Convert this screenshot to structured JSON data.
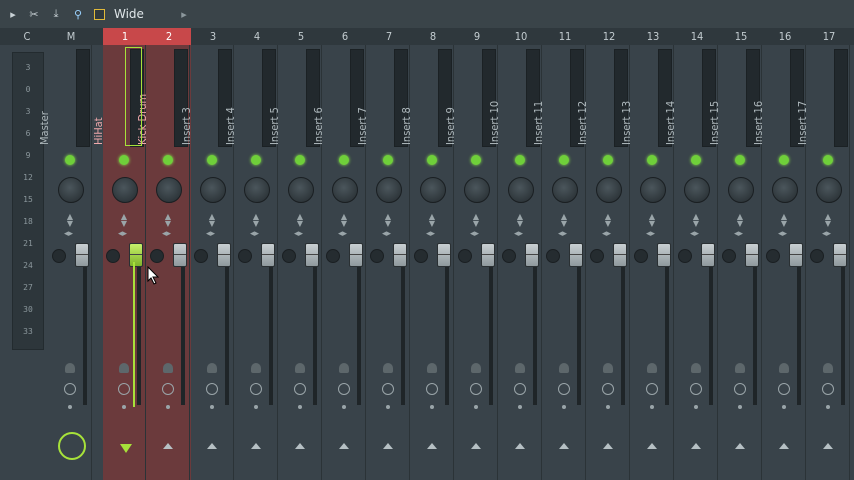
{
  "toolbar": {
    "preset": "Wide"
  },
  "header": {
    "c": "C",
    "m": "M",
    "numbers": [
      "1",
      "2",
      "3",
      "4",
      "5",
      "6",
      "7",
      "8",
      "9",
      "10",
      "11",
      "12",
      "13",
      "14",
      "15",
      "16",
      "17"
    ]
  },
  "scale": [
    "3",
    "0",
    "3",
    "6",
    "9",
    "12",
    "15",
    "18",
    "21",
    "24",
    "27",
    "30",
    "33"
  ],
  "channels": {
    "master": "Master",
    "inserts": [
      "HiHat",
      "Kick Drum",
      "Insert 3",
      "Insert 4",
      "Insert 5",
      "Insert 6",
      "Insert 7",
      "Insert 8",
      "Insert 9",
      "Insert 10",
      "Insert 11",
      "Insert 12",
      "Insert 13",
      "Insert 14",
      "Insert 15",
      "Insert 16",
      "Insert 17"
    ]
  },
  "colors": {
    "accent": "#c8484a",
    "selected": "#6b3a3c",
    "led": "#6fcf3a",
    "highlight": "#a7e23a"
  },
  "icons": [
    "play-icon",
    "wave-icon",
    "download-icon",
    "cursor-pointer-icon",
    "gear-icon"
  ]
}
